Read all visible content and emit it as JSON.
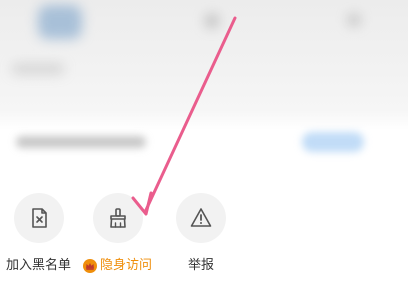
{
  "actions": [
    {
      "id": "blacklist",
      "label": "加入黑名单",
      "icon": "blocked-file-icon",
      "vip": false
    },
    {
      "id": "incognito",
      "label": "隐身访问",
      "icon": "broom-icon",
      "vip": true,
      "badge_icon": "crown-icon"
    },
    {
      "id": "report",
      "label": "举报",
      "icon": "warning-triangle-icon",
      "vip": false
    }
  ],
  "colors": {
    "vip_label": "#ef8e0b",
    "annotation_arrow": "#ea5d8d",
    "icon_stroke": "#555555",
    "circle_bg": "#f2f2f2"
  },
  "annotation": {
    "type": "arrow",
    "points_to": "incognito"
  }
}
